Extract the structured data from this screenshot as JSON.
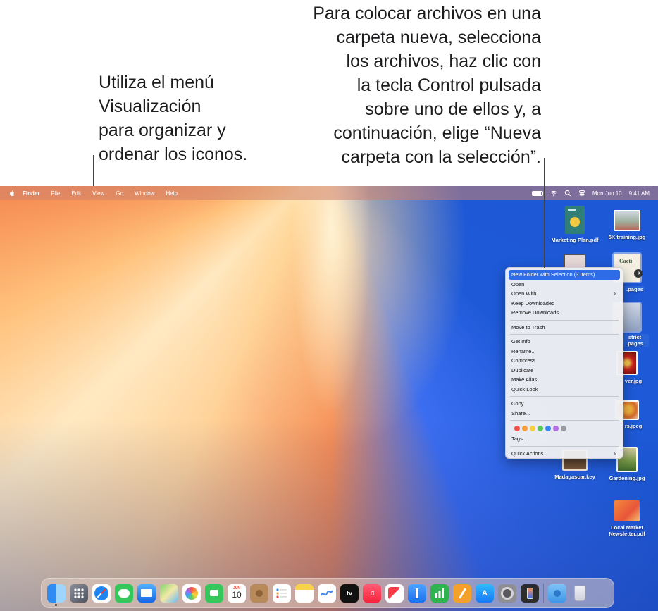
{
  "callouts": {
    "left": [
      "Utiliza el menú",
      "Visualización",
      "para organizar y",
      "ordenar los iconos."
    ],
    "right": [
      "Para colocar archivos en una",
      "carpeta nueva, selecciona",
      "los archivos, haz clic con",
      "la tecla Control pulsada",
      "sobre uno de ellos y, a",
      "continuación, elige “Nueva",
      "carpeta con la selección”."
    ]
  },
  "menubar": {
    "app": "Finder",
    "menus": [
      "File",
      "Edit",
      "View",
      "Go",
      "Window",
      "Help"
    ],
    "date": "Mon Jun 10",
    "time": "9:41 AM"
  },
  "desktop_icons": [
    {
      "name": "Marketing Plan.pdf",
      "selected": false
    },
    {
      "name": "5K training.jpg",
      "selected": false
    },
    {
      "name": "Cacti Station.pages",
      "label_visible": ".pages",
      "selected": true
    },
    {
      "name": "District Report.pages",
      "label_visible": "strict .pages",
      "selected": true
    },
    {
      "name": "Flower.jpg",
      "label_visible": "ver.jpg",
      "selected": false
    },
    {
      "name": "Flowers.jpeg",
      "label_visible": "rs.jpeg",
      "selected": false
    },
    {
      "name": "Madagascar.key",
      "selected": false
    },
    {
      "name": "Gardening.jpg",
      "selected": false
    },
    {
      "name": "Local Market Newsletter.pdf",
      "selected": false
    }
  ],
  "context_menu": {
    "groups": [
      [
        "New Folder with Selection (3 Items)",
        "Open",
        "Open With",
        "Keep Downloaded",
        "Remove Downloads"
      ],
      [
        "Move to Trash"
      ],
      [
        "Get Info",
        "Rename...",
        "Compress",
        "Duplicate",
        "Make Alias",
        "Quick Look"
      ],
      [
        "Copy",
        "Share..."
      ],
      [
        "Tags..."
      ],
      [
        "Quick Actions"
      ]
    ],
    "highlighted": "New Folder with Selection (3 Items)",
    "tag_colors": [
      "#f0524f",
      "#f5a13b",
      "#f7cf3c",
      "#5ac85b",
      "#3b86f0",
      "#b56ee6",
      "#9a9a9e"
    ]
  },
  "dock": {
    "calendar_month": "JUN",
    "calendar_day": "10",
    "apps": [
      "finder-icon",
      "launchpad-icon",
      "safari-icon",
      "messages-icon",
      "mail-icon",
      "maps-icon",
      "photos-icon",
      "facetime-icon",
      "calendar-icon",
      "contacts-icon",
      "reminders-icon",
      "notes-icon",
      "freeform-icon",
      "tv-icon",
      "music-icon",
      "news-icon",
      "keynote-icon",
      "numbers-icon",
      "pages-icon",
      "app-store-icon",
      "system-settings-icon",
      "iphone-mirroring-icon",
      "downloads-folder-icon",
      "trash-icon"
    ]
  }
}
